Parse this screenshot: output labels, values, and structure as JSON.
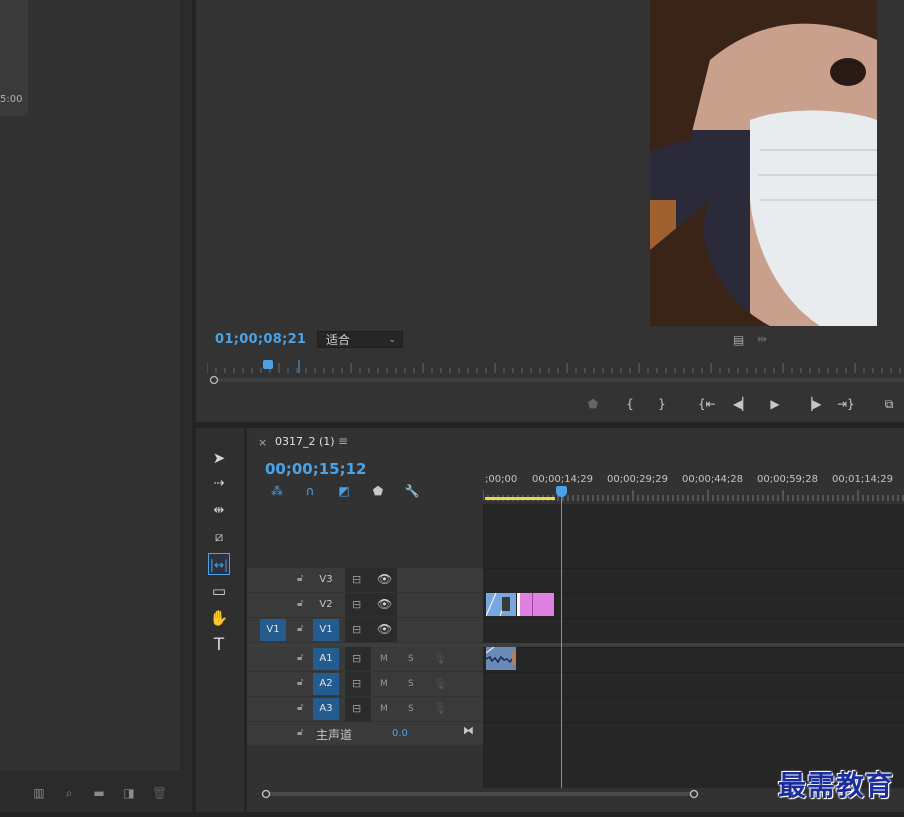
{
  "project_panel": {
    "thumb_time": "5:00"
  },
  "program_monitor": {
    "timecode": "01;00;08;21",
    "fit": "适合",
    "transport": [
      "marker-icon",
      "mark-in-icon",
      "mark-out-icon",
      "go-to-in-icon",
      "step-back-icon",
      "play-icon",
      "step-forward-icon",
      "go-to-out-icon",
      "insert-icon"
    ]
  },
  "timeline": {
    "sequence_name": "0317_2 (1)",
    "close": "×",
    "menu": "≡",
    "timecode": "00;00;15;12",
    "ruler_labels": [
      ";00;00",
      "00;00;14;29",
      "00;00;29;29",
      "00;00;44;28",
      "00;00;59;28",
      "00;01;14;29"
    ],
    "video_tracks": [
      {
        "name": "V3",
        "source": ""
      },
      {
        "name": "V2",
        "source": ""
      },
      {
        "name": "V1",
        "source": "V1"
      }
    ],
    "audio_tracks": [
      {
        "name": "A1",
        "m": "M",
        "s": "S"
      },
      {
        "name": "A2",
        "m": "M",
        "s": "S"
      },
      {
        "name": "A3",
        "m": "M",
        "s": "S"
      }
    ],
    "master": {
      "label": "主声道",
      "value": "0.0"
    }
  },
  "watermark": "最需教育",
  "colors": {
    "accent": "#4aa3e8",
    "track_active": "#245c8f",
    "clip_pink": "#e080e0",
    "clip_blue": "#7aa6e0"
  }
}
